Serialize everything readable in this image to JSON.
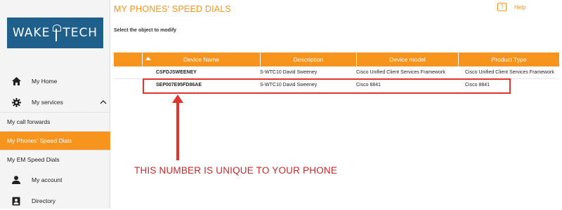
{
  "sidebar": {
    "logo_text_left": "WAKE",
    "logo_text_right": "TECH",
    "items": [
      {
        "label": "My Home",
        "icon": "home-icon"
      },
      {
        "label": "My services",
        "icon": "gear-icon"
      },
      {
        "label": "My account",
        "icon": "person-icon"
      },
      {
        "label": "Directory",
        "icon": "contact-card-icon"
      }
    ],
    "sub_items": [
      {
        "label": "My call forwards"
      },
      {
        "label": "My Phones' Speed Dials"
      },
      {
        "label": "My EM Speed Dials"
      }
    ]
  },
  "header": {
    "title": "MY PHONES' SPEED DIALS",
    "help_label": "Help"
  },
  "main": {
    "subtitle": "Select the object to modify",
    "columns": [
      "Device Name",
      "Description",
      "Device model",
      "Product Type"
    ],
    "rows": [
      {
        "device_name": "CSFDJSWEENEY",
        "description": "S-WTC10 David Sweeney",
        "device_model": "Cisco Unified Client Services Framework",
        "product_type": "Cisco Unified Client Services Framework"
      },
      {
        "device_name": "SEP007E95FD86AE",
        "description": "S-WTC10 David Sweeney",
        "device_model": "Cisco 8841",
        "product_type": "Cisco 8841"
      }
    ]
  },
  "annotation": {
    "text": "THIS NUMBER IS UNIQUE TO YOUR PHONE",
    "color": "#c8282a"
  },
  "colors": {
    "accent": "#f7941d",
    "logo_bg": "#1f5f8b",
    "highlight": "#e0342c"
  }
}
